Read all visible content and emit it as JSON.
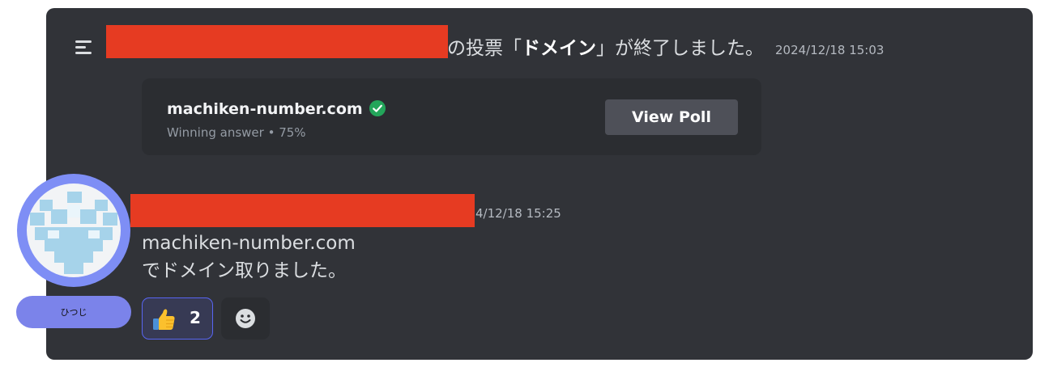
{
  "system_message": {
    "text_before": "の投票「",
    "poll_name": "ドメイン",
    "text_after": "」が終了しました。",
    "timestamp": "2024/12/18 15:03"
  },
  "poll_result": {
    "winning_answer": "machiken-number.com",
    "subtitle": "Winning answer • 75%",
    "view_button_label": "View Poll"
  },
  "message": {
    "timestamp": "4/12/18 15:25",
    "line1": "machiken-number.com",
    "line2": "でドメイン取りました。"
  },
  "reactions": [
    {
      "emoji": "thumbs-up-icon",
      "count": "2"
    }
  ],
  "user": {
    "name_tag": "ひつじ"
  },
  "colors": {
    "panel_bg": "#313338",
    "redaction": "#e63b22",
    "reaction_border": "#5865f2",
    "check_green": "#23a55a",
    "avatar_ring": "#7e8ef5",
    "avatar_pattern": "#a6d3ea"
  }
}
